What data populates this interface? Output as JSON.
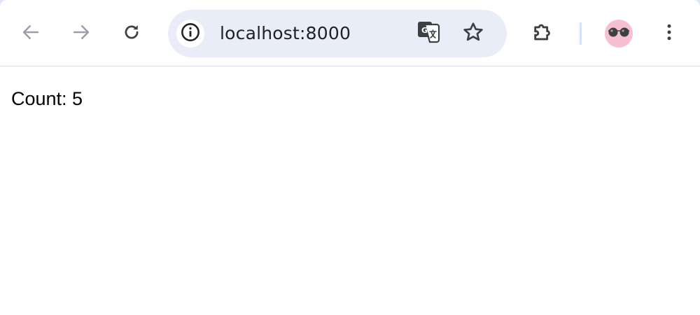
{
  "browser": {
    "address_bar": {
      "url": "localhost:8000"
    },
    "icons": {
      "back": "arrow-left-icon",
      "forward": "arrow-right-icon",
      "reload": "reload-icon",
      "site_info": "info-icon",
      "translate": "translate-icon",
      "bookmark": "star-icon",
      "extensions": "puzzle-icon",
      "profile": "avatar-sunglasses-icon",
      "menu": "more-vert-icon"
    },
    "colors": {
      "omnibox_bg": "#e9edf7",
      "tabstrip_bg": "#dfe6f6",
      "avatar_bg": "#f4c0d2",
      "icon_active": "#3c4043",
      "icon_disabled": "#9aa0a6"
    }
  },
  "page": {
    "count_text": "Count: 5"
  }
}
